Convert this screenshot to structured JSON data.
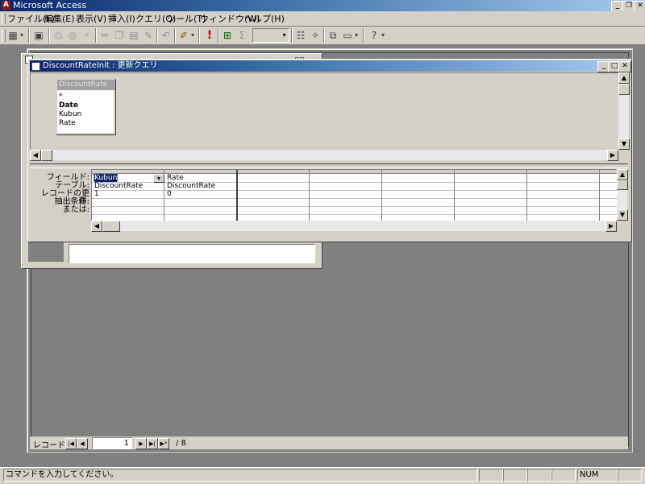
{
  "app": {
    "title": "Microsoft Access"
  },
  "menu": {
    "items": [
      "ファイル(F)",
      "編集(E)",
      "表示(V)",
      "挿入(I)",
      "クエリ(Q)",
      "ツール(T)",
      "ウィンドウ(W)",
      "ヘルプ(H)"
    ]
  },
  "toolbar": {
    "sigma": "Σ",
    "run": "!",
    "combo_value": ""
  },
  "query_window": {
    "title": "DiscountRateInit : 更新クエリ",
    "table_box": {
      "title": "DiscountRate",
      "fields": [
        "*",
        "Date",
        "Kubun",
        "Rate"
      ]
    },
    "grid": {
      "row_labels": [
        "フィールド:",
        "テーブル:",
        "レコードの更新:",
        "抽出条件:",
        "または:"
      ],
      "columns": [
        {
          "field": "Kubun",
          "table": "DiscountRate",
          "update": "1"
        },
        {
          "field": "Rate",
          "table": "DiscountRate",
          "update": "0"
        }
      ]
    }
  },
  "record_nav": {
    "label": "レコード:",
    "current": "1",
    "total": "/ 8"
  },
  "status": {
    "message": "コマンドを入力してください。",
    "num": "NUM"
  }
}
